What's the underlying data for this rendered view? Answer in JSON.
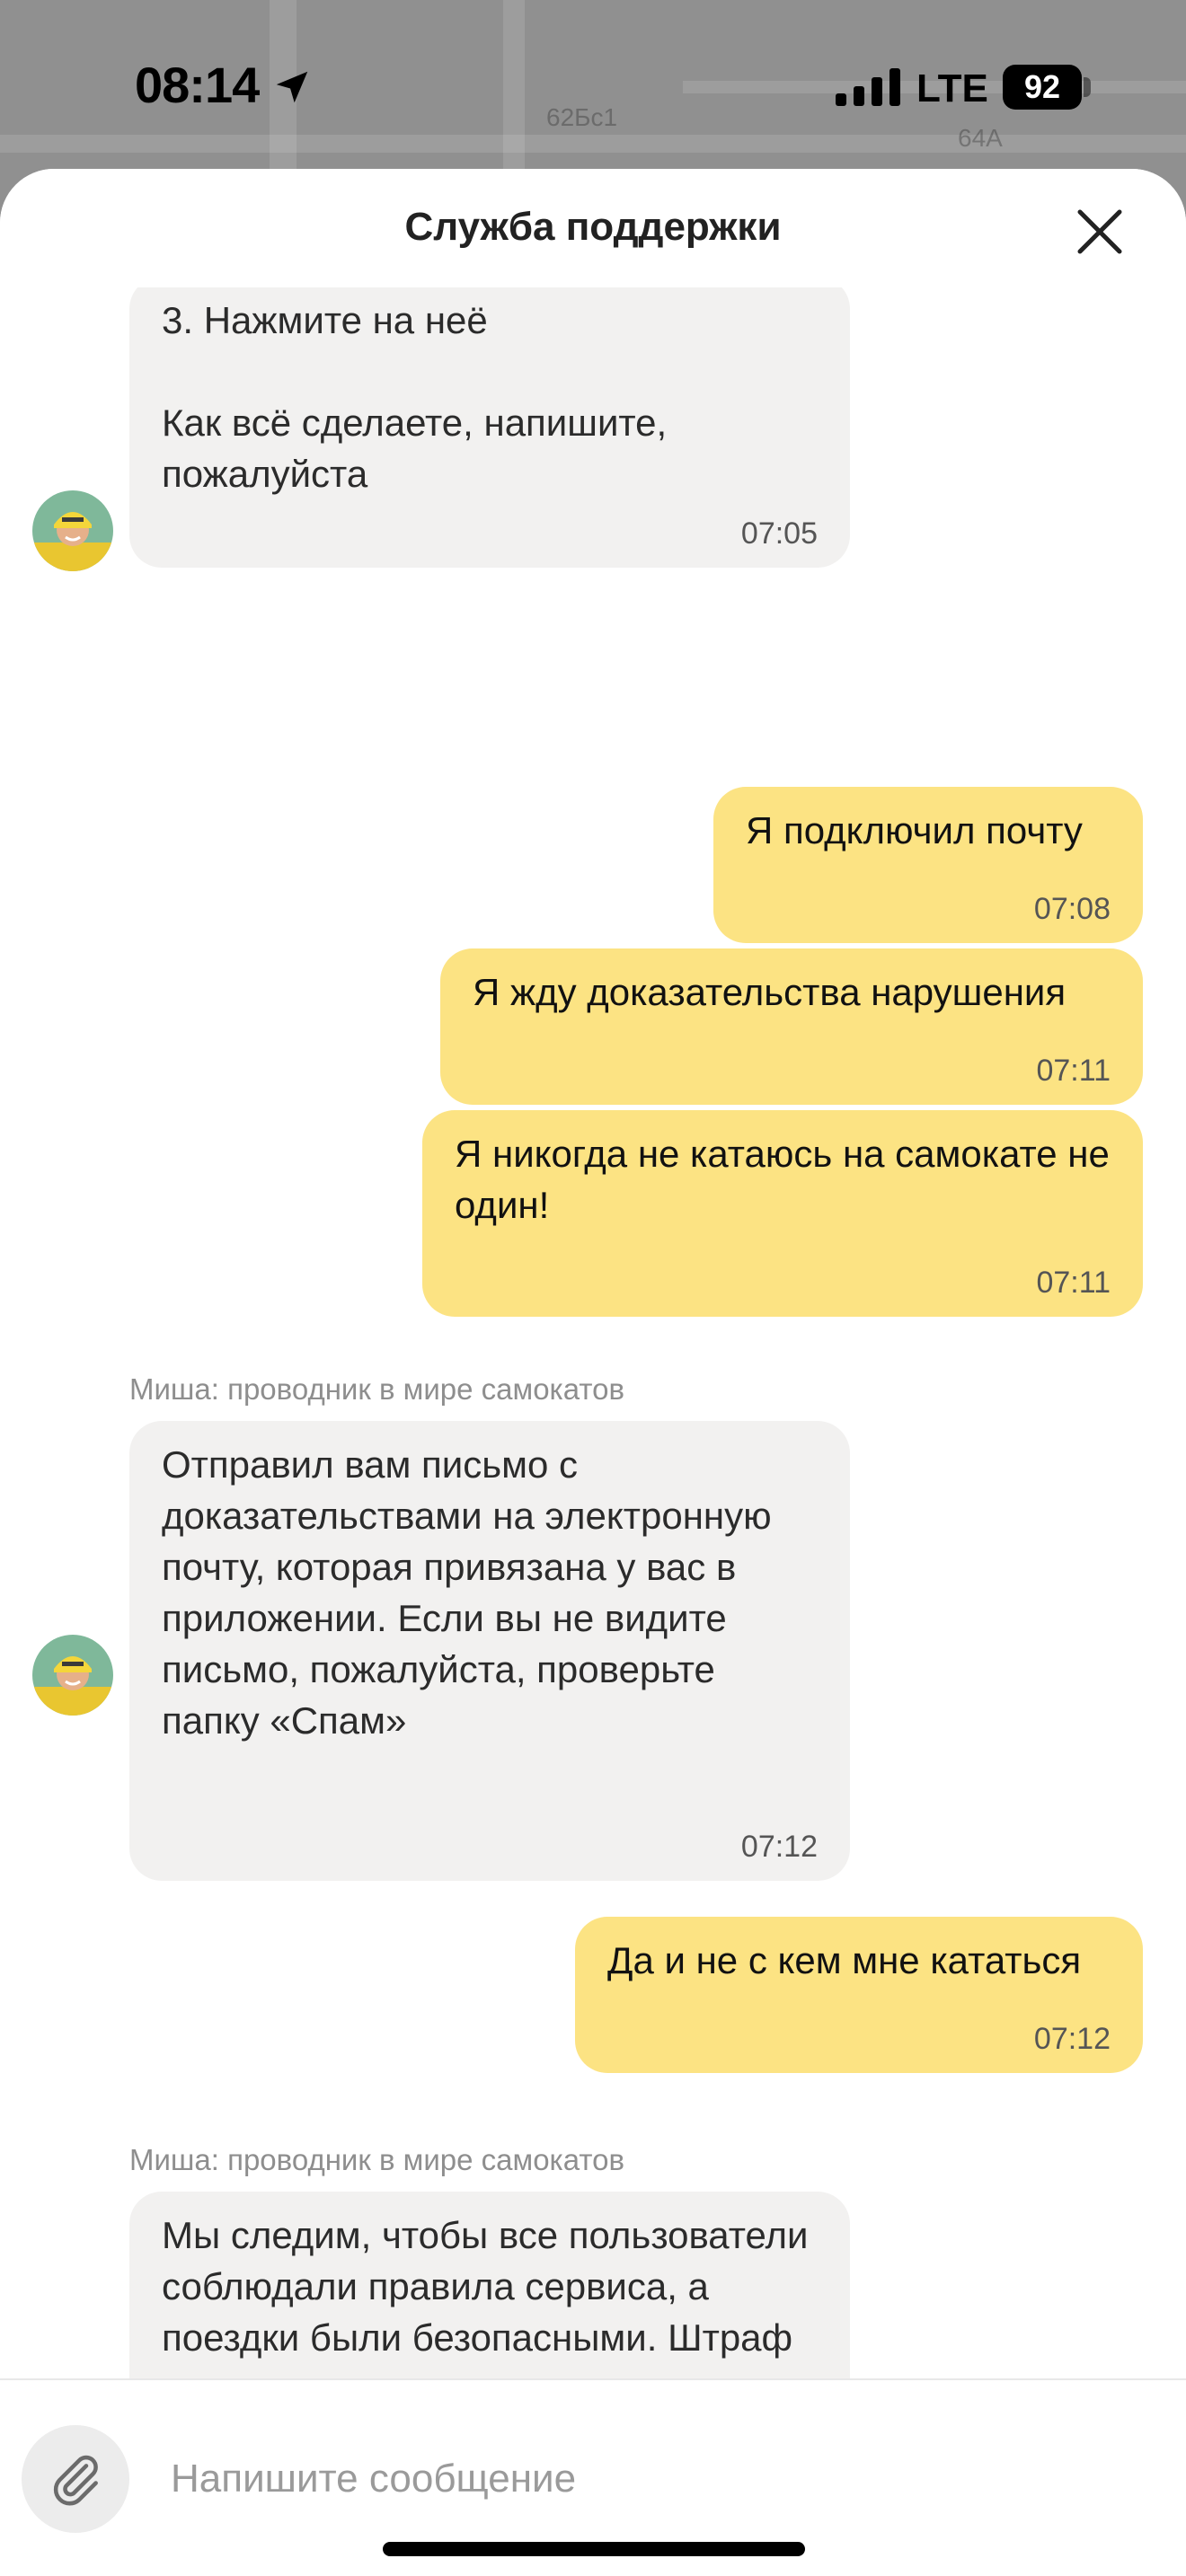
{
  "status_bar": {
    "time": "08:14",
    "network": "LTE",
    "battery": "92"
  },
  "map": {
    "labels": [
      "62Бс1",
      "64А"
    ]
  },
  "header": {
    "title": "Служба поддержки"
  },
  "messages": [
    {
      "direction": "in",
      "text": "3. Нажмите на неё\n\nКак всё сделаете, напишите, пожалуйста",
      "time": "07:05"
    },
    {
      "direction": "out",
      "text": "Я подключил почту",
      "time": "07:08"
    },
    {
      "direction": "out",
      "text": "Я жду доказательства нарушения",
      "time": "07:11"
    },
    {
      "direction": "out",
      "text": "Я никогда не катаюсь на самокате не один!",
      "time": "07:11"
    },
    {
      "direction": "in",
      "sender": "Миша: проводник в мире самокатов",
      "text": "Отправил вам письмо с доказательствами на электронную почту, которая привязана у вас в приложении. Если вы не видите письмо, пожалуйста, проверьте папку «Спам»",
      "time": "07:12"
    },
    {
      "direction": "out",
      "text": "Да и не с кем мне кататься",
      "time": "07:12"
    },
    {
      "direction": "in",
      "sender": "Миша: проводник в мире самокатов",
      "text": "Мы следим, чтобы все пользователи соблюдали правила сервиса, а поездки были безопасными. Штраф выписывается, только если есть доказательства нарушений."
    }
  ],
  "composer": {
    "placeholder": "Напишите сообщение"
  },
  "colors": {
    "outgoing_bubble": "#fce383",
    "incoming_bubble": "#f2f1f0",
    "sender_name": "#8e8e8e"
  },
  "icons": [
    "location-arrow-icon",
    "signal-icon",
    "battery-icon",
    "close-icon",
    "paperclip-icon",
    "avatar-icon"
  ]
}
